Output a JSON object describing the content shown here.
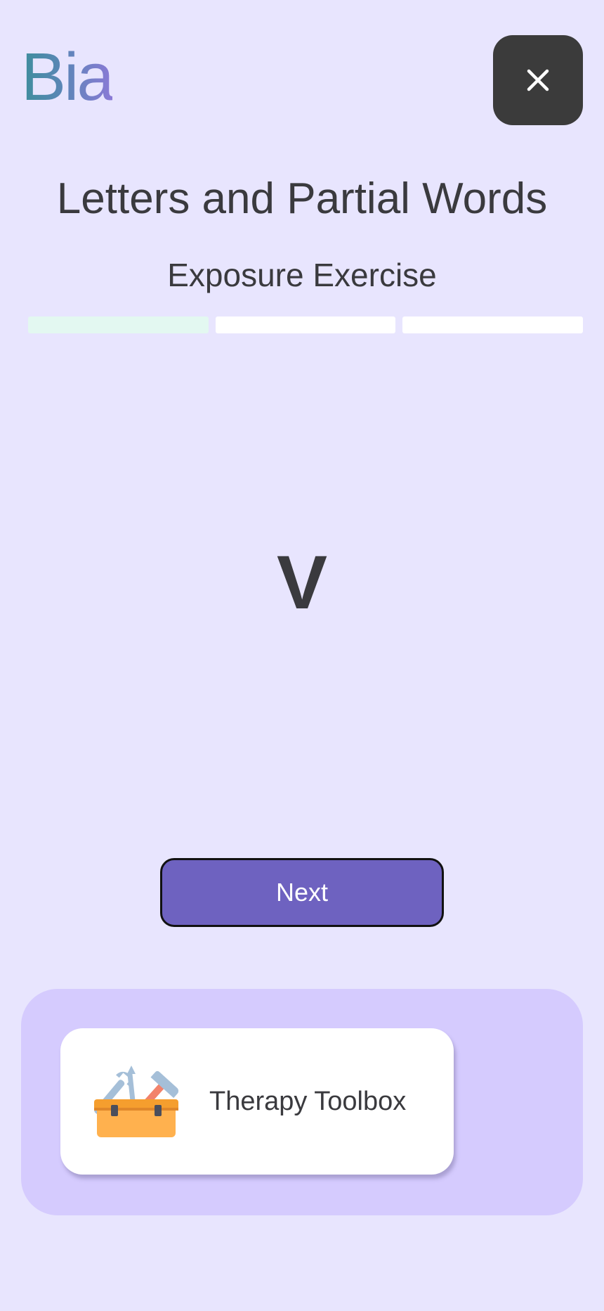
{
  "app": {
    "logo_text": "Bia",
    "logo_gradient": [
      "#3e8e9c",
      "#8a7ad6"
    ]
  },
  "header": {
    "close_icon": "close-icon"
  },
  "exercise": {
    "title": "Letters and Partial Words",
    "subtitle": "Exposure Exercise",
    "progress": {
      "total_steps": 3,
      "completed_steps": 1
    },
    "stimulus": "V"
  },
  "actions": {
    "next_label": "Next"
  },
  "toolbox": {
    "label": "Therapy Toolbox",
    "icon": "toolbox-icon"
  },
  "colors": {
    "background": "#e8e5fe",
    "primary_button": "#6e62c0",
    "close_button": "#3b3b3b",
    "panel": "#d5cbfe",
    "progress_done": "#e3f8f1",
    "progress_pending": "#ffffff"
  }
}
